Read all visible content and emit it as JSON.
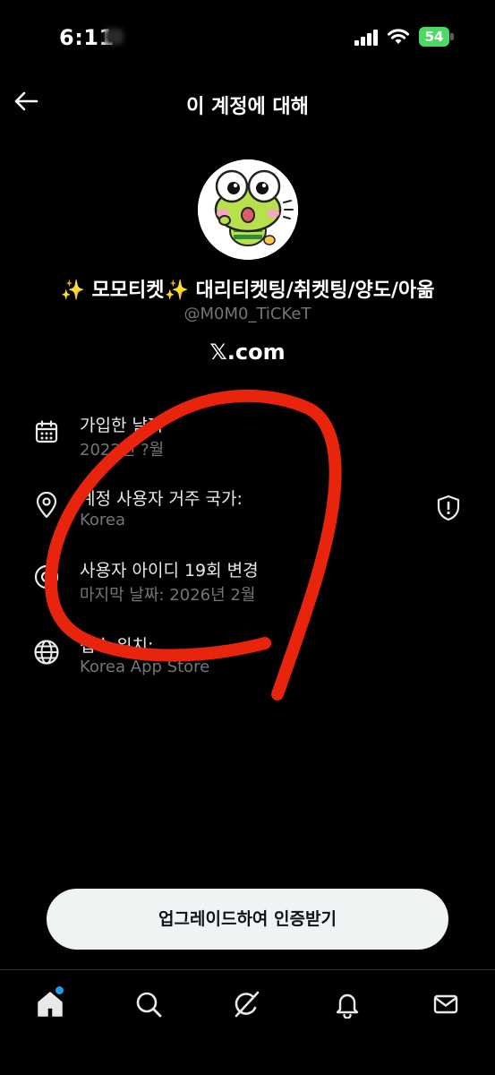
{
  "status_bar": {
    "time": "6:11",
    "battery": "54"
  },
  "header": {
    "title": "이 계정에 대해"
  },
  "profile": {
    "sparkle_left": "✨",
    "name_part1": " 모모티켓",
    "sparkle_right": "✨",
    "name_part2": " 대리티켓팅/취켓팅/양도/아옮",
    "handle": "@M0M0_TiCKeT",
    "platform": "𝕏.com"
  },
  "info": {
    "joined": {
      "title": "가입한 날짜",
      "value": "2022년 ?월"
    },
    "country": {
      "title": "계정 사용자 거주 국가:",
      "value": "Korea"
    },
    "username": {
      "title": "사용자 아이디 19회 변경",
      "value": "마지막 날짜: 2026년 2월"
    },
    "location": {
      "title": "접속 위치:",
      "value": "Korea App Store"
    }
  },
  "upgrade": {
    "label": "업그레이드하여 인증받기"
  },
  "icons": {
    "back": "arrow-left-icon",
    "calendar": "calendar-icon",
    "pin": "location-pin-icon",
    "at": "at-sign-icon",
    "globe": "globe-icon",
    "shield": "shield-alert-icon",
    "home": "home-icon",
    "search": "search-icon",
    "grok": "grok-icon",
    "bell": "bell-icon",
    "mail": "mail-icon"
  },
  "colors": {
    "background": "#000000",
    "annotation": "#e8250c",
    "accent": "#1d9bf0",
    "muted_text": "#71767b",
    "battery": "#4cd964"
  }
}
